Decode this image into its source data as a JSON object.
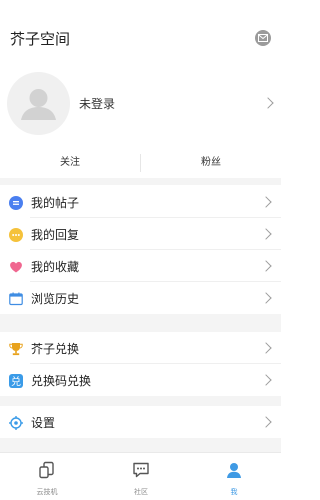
{
  "header": {
    "title": "芥子空间",
    "mail_icon": "mail-icon"
  },
  "profile": {
    "login_label": "未登录",
    "avatar_icon": "default-avatar-icon"
  },
  "follow": {
    "following_label": "关注",
    "fans_label": "粉丝"
  },
  "menu_group1": [
    {
      "label": "我的帖子",
      "icon": "posts-icon",
      "color": "#4a7ff0"
    },
    {
      "label": "我的回复",
      "icon": "reply-icon",
      "color": "#f5c23b"
    },
    {
      "label": "我的收藏",
      "icon": "heart-icon",
      "color": "#f06790"
    },
    {
      "label": "浏览历史",
      "icon": "calendar-icon",
      "color": "#3f8de3"
    }
  ],
  "menu_group2": [
    {
      "label": "芥子兑换",
      "icon": "trophy-icon",
      "color": "#e8a21c"
    },
    {
      "label": "兑换码兑换",
      "icon": "exchange-icon",
      "color": "#3a9be8",
      "glyph": "兑"
    }
  ],
  "menu_group3": [
    {
      "label": "设置",
      "icon": "settings-icon",
      "color": "#3a9be8"
    }
  ],
  "tabbar": [
    {
      "label": "云技机",
      "icon": "cloud-device-icon",
      "active": false
    },
    {
      "label": "社区",
      "icon": "community-icon",
      "active": false
    },
    {
      "label": "我",
      "icon": "profile-icon",
      "active": true
    }
  ],
  "colors": {
    "accent": "#3f9ae4",
    "background_gap": "#f4f4f4"
  }
}
